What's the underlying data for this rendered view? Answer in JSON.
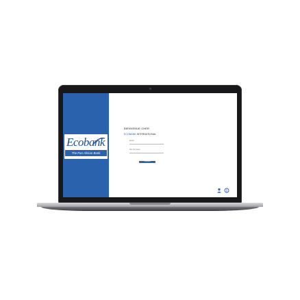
{
  "brand": {
    "logo_text": "Ecobank",
    "tagline": "The Pan African Bank",
    "primary_color": "#2a62ad"
  },
  "login": {
    "welcome_text": "BIENVENUE CHER",
    "org_prefix": "ECOBANK",
    "org_suffix": "INTERNATIONAL",
    "field1_label": "Email",
    "field2_label": "Mot de passe",
    "submit_label": "Connexion"
  },
  "corner_icons": [
    "user-icon",
    "info-icon"
  ]
}
